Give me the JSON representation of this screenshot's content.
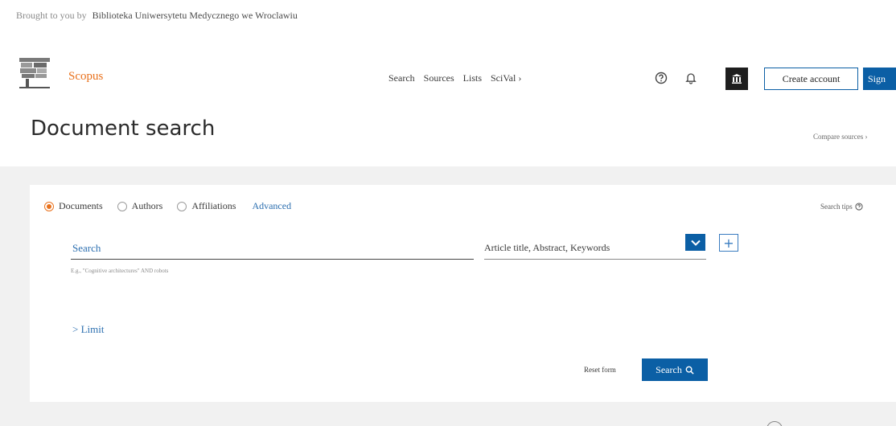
{
  "institution": {
    "prefix": "Brought to you by",
    "name": "Biblioteka Uniwersytetu Medycznego we Wroclawiu"
  },
  "header": {
    "brand": "Scopus",
    "nav": [
      "Search",
      "Sources",
      "Lists",
      "SciVal ›"
    ],
    "create_account": "Create account",
    "sign_in": "Sign"
  },
  "page": {
    "title": "Document search",
    "compare_sources": "Compare sources ›"
  },
  "search": {
    "options": [
      {
        "label": "Documents",
        "selected": true
      },
      {
        "label": "Authors",
        "selected": false
      },
      {
        "label": "Affiliations",
        "selected": false
      }
    ],
    "advanced": "Advanced",
    "search_tips": "Search tips",
    "placeholder": "Search",
    "hint": "E.g., \"Cognitive architectures\" AND robots",
    "field": "Article title, Abstract, Keywords",
    "limit": "> Limit",
    "reset": "Reset form",
    "submit": "Search"
  },
  "colors": {
    "accent_blue": "#0b5fa5",
    "brand_orange": "#e9711c",
    "link_blue": "#2c6fb0"
  },
  "icons": {
    "help": "help-circle-icon",
    "bell": "bell-icon",
    "institution": "institution-icon",
    "dropdown": "chevron-down-icon",
    "add": "plus-icon",
    "magnifier": "search-icon"
  }
}
